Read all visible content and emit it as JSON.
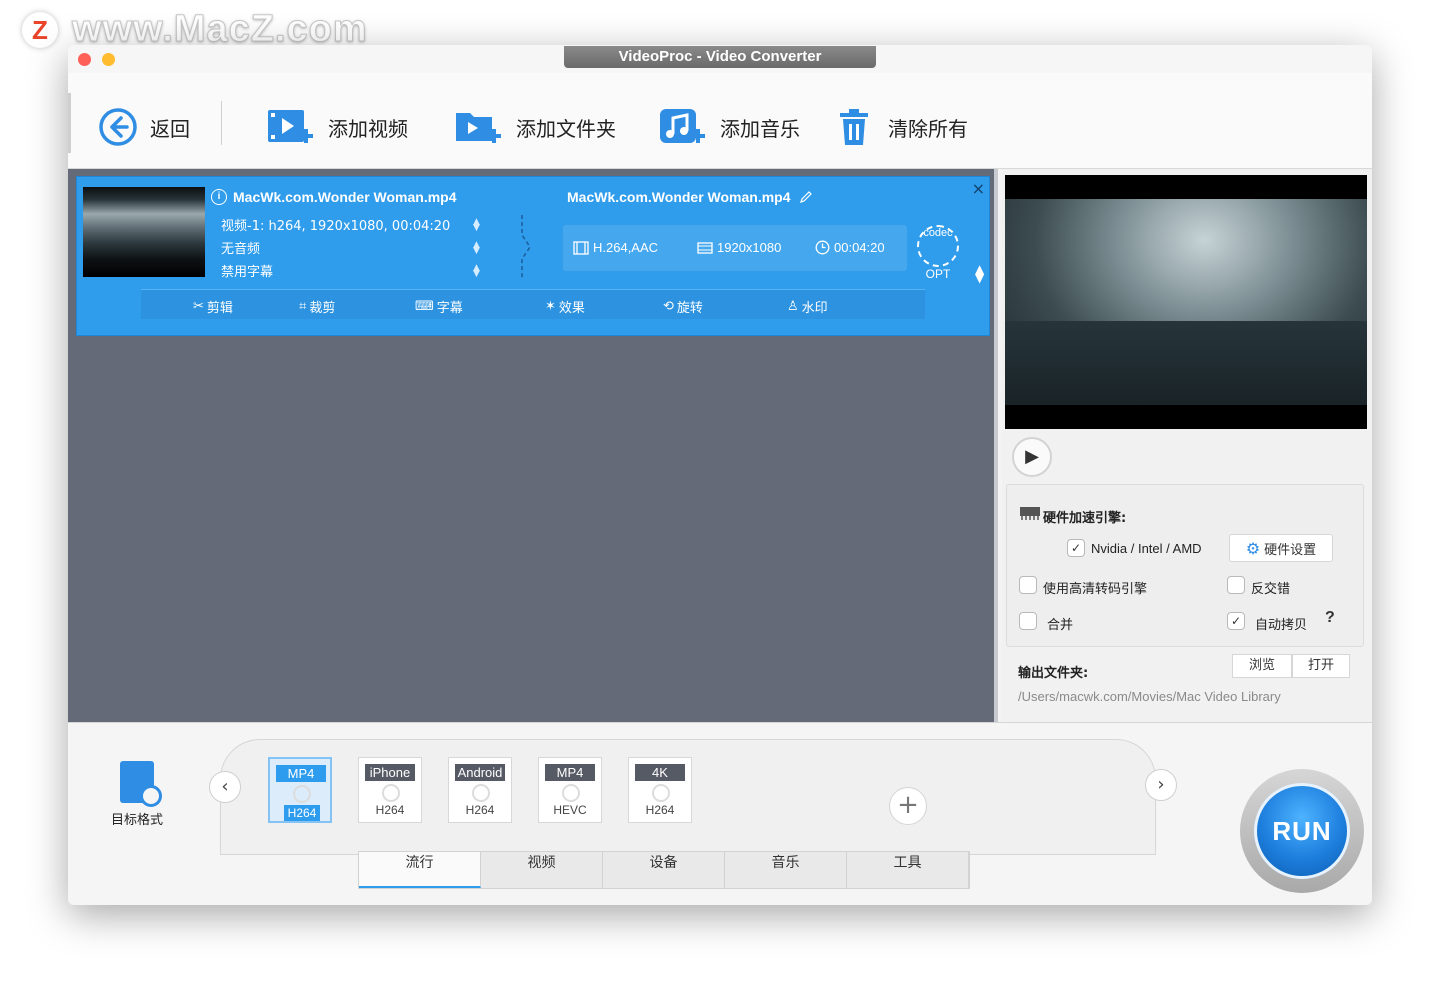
{
  "watermark": {
    "logo": "Z",
    "text": "www.MacZ.com"
  },
  "window": {
    "title": "VideoProc - Video Converter"
  },
  "toolbar": {
    "back": "返回",
    "add_video": "添加视频",
    "add_folder": "添加文件夹",
    "add_music": "添加音乐",
    "clear_all": "清除所有"
  },
  "item": {
    "source_name": "MacWk.com.Wonder Woman.mp4",
    "video_track": "视频-1: h264, 1920x1080, 00:04:20",
    "audio_track": "无音频",
    "subtitle_track": "禁用字幕",
    "output_name": "MacWk.com.Wonder Woman.mp4",
    "codec_info": "H.264,AAC",
    "resolution": "1920x1080",
    "duration": "00:04:20",
    "codec_badge": "codec",
    "opt_label": "OPT",
    "close": "×",
    "tools": {
      "edit": "剪辑",
      "crop": "裁剪",
      "subtitle": "字幕",
      "effect": "效果",
      "rotate": "旋转",
      "watermark": "水印"
    }
  },
  "settings": {
    "hw_title": "硬件加速引擎:",
    "hw_vendor": "Nvidia /  Intel / AMD",
    "hw_settings": "硬件设置",
    "hq_engine": "使用高清转码引擎",
    "deinterlace": "反交错",
    "merge": "合并",
    "auto_copy": "自动拷贝",
    "help": "?",
    "output_label": "输出文件夹:",
    "browse": "浏览",
    "open": "打开",
    "output_path": "/Users/macwk.com/Movies/Mac Video Library",
    "checks": {
      "hw": true,
      "hq": false,
      "deint": false,
      "merge": false,
      "auto": true
    }
  },
  "bottom": {
    "target_format": "目标格式",
    "formats": [
      {
        "top": "MP4",
        "bottom": "H264",
        "selected": true
      },
      {
        "top": "iPhone",
        "bottom": "H264",
        "selected": false
      },
      {
        "top": "Android",
        "bottom": "H264",
        "selected": false
      },
      {
        "top": "MP4",
        "bottom": "HEVC",
        "selected": false
      },
      {
        "top": "4K",
        "bottom": "H264",
        "selected": false
      }
    ],
    "tabs": [
      "流行",
      "视频",
      "设备",
      "音乐",
      "工具"
    ],
    "active_tab": 0,
    "run": "RUN"
  },
  "colors": {
    "accent": "#2f9cec",
    "list_bg": "#646a78",
    "run": "#1e7fdd"
  }
}
